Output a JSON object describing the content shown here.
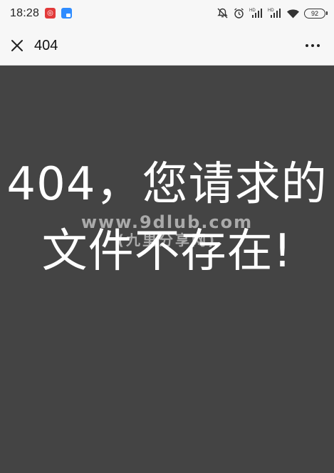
{
  "status_bar": {
    "time": "18:28",
    "battery_level": "92",
    "icons": [
      "netease-music-icon",
      "blue-app-icon",
      "mute-icon",
      "alarm-icon",
      "hd-signal-icon",
      "hd-signal-icon",
      "wifi-icon",
      "battery-icon"
    ]
  },
  "title_bar": {
    "title": "404",
    "close_icon": "close-icon",
    "more_icon": "more-icon"
  },
  "content": {
    "error_message": "404，您请求的文件不存在!",
    "background_color": "#444444",
    "watermark_line1": "www.9dlub.com",
    "watermark_line2": "(九里分享网)"
  }
}
